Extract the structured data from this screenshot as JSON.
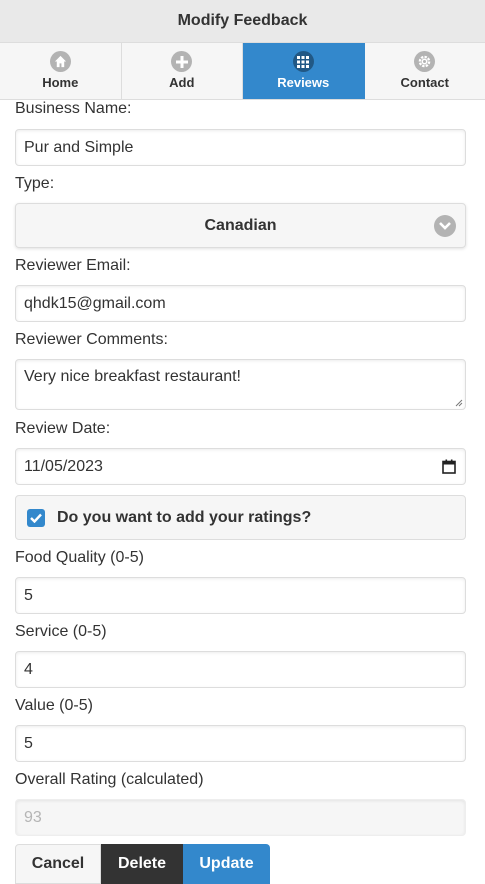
{
  "header": {
    "title": "Modify Feedback"
  },
  "nav": {
    "items": [
      {
        "label": "Home",
        "icon": "home-icon"
      },
      {
        "label": "Add",
        "icon": "plus-icon"
      },
      {
        "label": "Reviews",
        "icon": "grid-icon",
        "active": true
      },
      {
        "label": "Contact",
        "icon": "gear-icon"
      }
    ]
  },
  "form": {
    "business_name_label": "Business Name:",
    "business_name_value": "Pur and Simple",
    "type_label": "Type:",
    "type_value": "Canadian",
    "email_label": "Reviewer Email:",
    "email_value": "qhdk15@gmail.com",
    "comments_label": "Reviewer Comments:",
    "comments_value": "Very nice breakfast restaurant!",
    "date_label": "Review Date:",
    "date_value": "11/05/2023",
    "ratings_checkbox_label": "Do you want to add your ratings?",
    "ratings_checked": true,
    "food_label": "Food Quality (0-5)",
    "food_value": "5",
    "service_label": "Service (0-5)",
    "service_value": "4",
    "value_label": "Value (0-5)",
    "value_value": "5",
    "overall_label": "Overall Rating (calculated)",
    "overall_value": "93"
  },
  "buttons": {
    "cancel": "Cancel",
    "delete": "Delete",
    "update": "Update"
  },
  "colors": {
    "accent": "#3388cc",
    "dark": "#333333",
    "header_bg": "#e9e9e9"
  }
}
